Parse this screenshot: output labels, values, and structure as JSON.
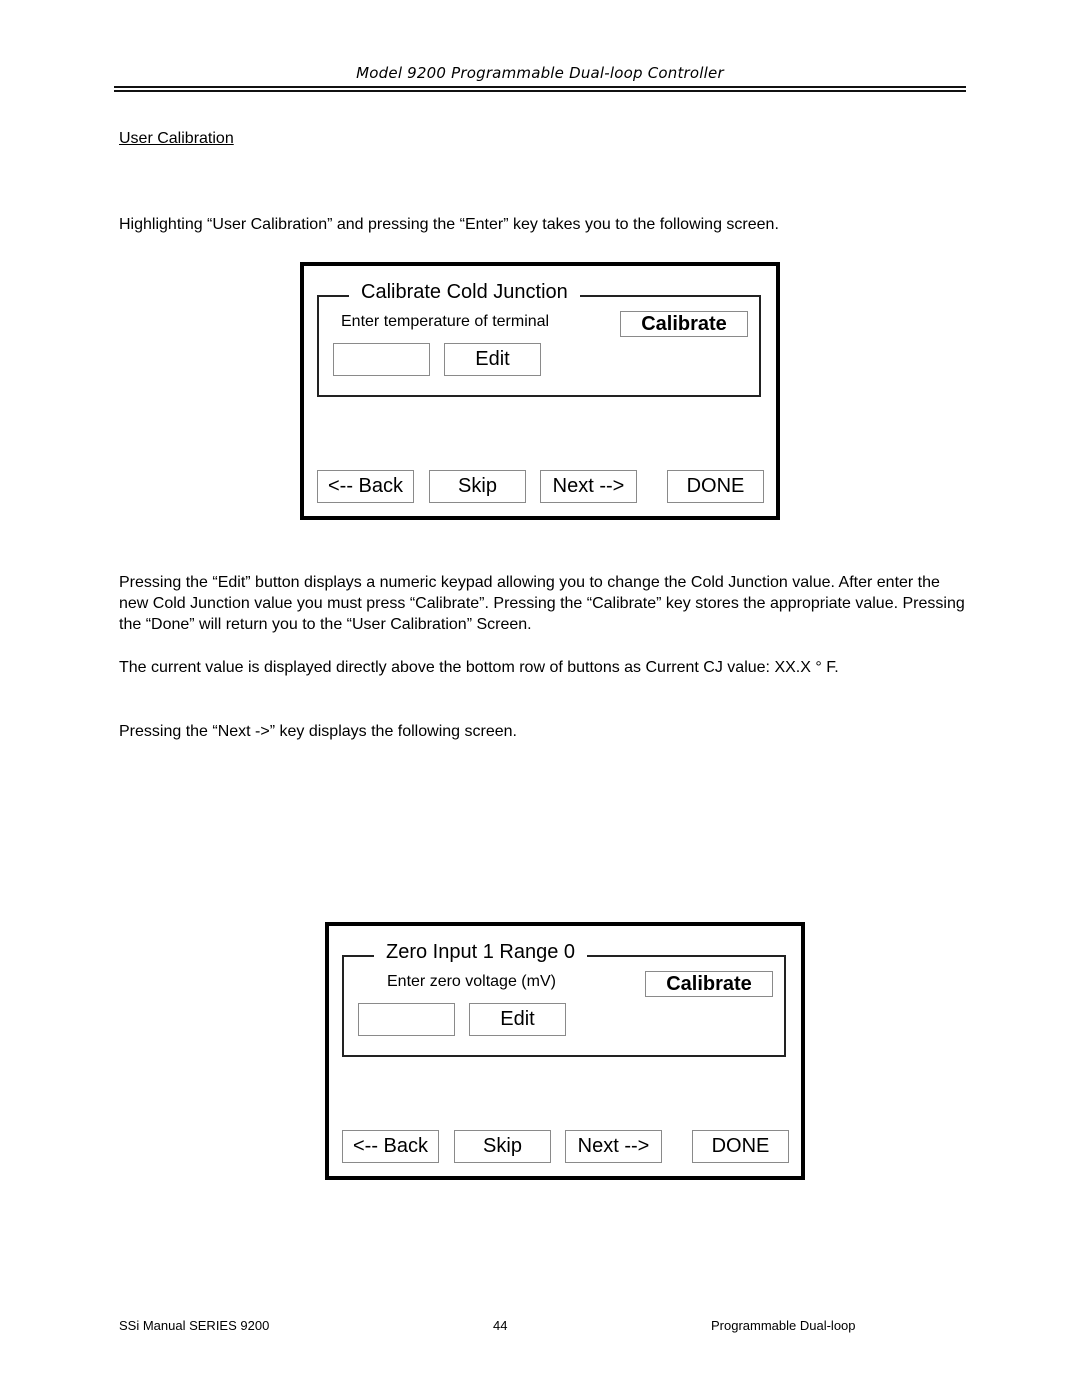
{
  "header": {
    "running_title": "Model 9200 Programmable Dual-loop Controller"
  },
  "section": {
    "heading": "User Calibration"
  },
  "paragraphs": {
    "intro": "Highlighting “User Calibration” and pressing the “Enter” key takes you to the following screen.",
    "edit_explanation": "Pressing the “Edit” button displays a numeric keypad allowing you to change the Cold Junction value. After enter the new Cold Junction value you must press “Calibrate”. Pressing the “Calibrate” key stores the appropriate value. Pressing the “Done” will return you to the “User Calibration” Screen.",
    "current_value": "The current value is displayed directly above the bottom row of buttons as Current CJ value: XX.X ° F.",
    "next_intro": "Pressing the “Next ->” key displays the following screen."
  },
  "screens": [
    {
      "group_title": "Calibrate Cold Junction",
      "prompt": "Enter temperature of terminal",
      "calibrate_label": "Calibrate",
      "value": "",
      "edit_label": "Edit",
      "back_label": "<-- Back",
      "skip_label": "Skip",
      "next_label": "Next -->",
      "done_label": "DONE"
    },
    {
      "group_title": "Zero Input 1 Range 0",
      "prompt": "Enter zero voltage (mV)",
      "calibrate_label": "Calibrate",
      "value": "",
      "edit_label": "Edit",
      "back_label": "<-- Back",
      "skip_label": "Skip",
      "next_label": "Next -->",
      "done_label": "DONE"
    }
  ],
  "footer": {
    "left": "SSi Manual SERIES 9200",
    "page_number": "44",
    "right": "Programmable Dual-loop"
  }
}
